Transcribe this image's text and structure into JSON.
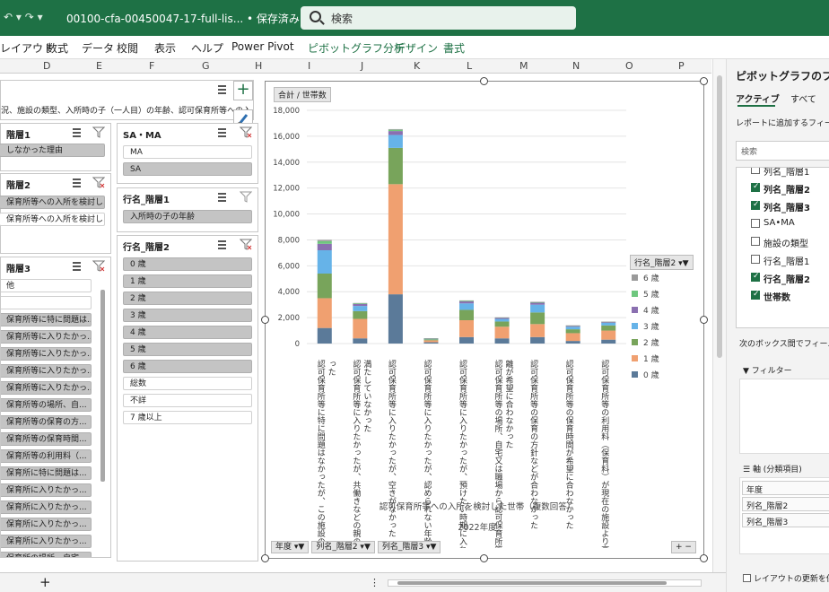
{
  "titlebar": {
    "undo_glyph": "↶ ▾ ↷ ▾",
    "filename": "00100-cfa-00450047-17-full-lis... • 保存済み ∨",
    "search_placeholder": "検索"
  },
  "ribbon_tabs": [
    "レイアウト",
    "数式",
    "データ",
    "校閲",
    "表示",
    "ヘルプ",
    "Power Pivot",
    "ピボットグラフ分析",
    "デザイン",
    "書式"
  ],
  "columns": [
    "D",
    "E",
    "F",
    "G",
    "H",
    "I",
    "J",
    "K",
    "L",
    "M",
    "N",
    "O",
    "P"
  ],
  "slicer_top": {
    "text": "況、施設の類型、入所時の子（一人目）の年齢、認可保育所等への入"
  },
  "slicer_a": {
    "header": "階層1",
    "items": [
      "しなかった理由"
    ]
  },
  "slicer_b": {
    "header": "階層2",
    "items": [
      "保育所等への入所を検討し...",
      "保育所等への入所を検討し..."
    ]
  },
  "slicer_c": {
    "header": "階層3",
    "items": [
      "他",
      "",
      "保育所等に特に問題は...",
      "保育所等に入りたかっ...",
      "保育所等に入りたかっ...",
      "保育所等に入りたかっ...",
      "保育所等に入りたかっ...",
      "保育所等の場所、自...",
      "保育所等の保育の方...",
      "保育所等の保育時間...",
      "保育所等の利用料（...",
      "保育所に特に問題は...",
      "保育所に入りたかっ...",
      "保育所に入りたかっ...",
      "保育所に入りたかっ...",
      "保育所に入りたかっ...",
      "保育所の場所、自宅..."
    ]
  },
  "slicer_sama": {
    "header": "SA・MA",
    "items": [
      "MA",
      "SA"
    ]
  },
  "slicer_row1": {
    "header": "行名_階層1",
    "items": [
      "入所時の子の年齢"
    ]
  },
  "slicer_row2": {
    "header": "行名_階層2",
    "items": [
      "0 歳",
      "1 歳",
      "2 歳",
      "3 歳",
      "4 歳",
      "5 歳",
      "6 歳",
      "総数",
      "不詳",
      "7 歳以上"
    ]
  },
  "chart": {
    "value_button": "合計 / 世帯数",
    "legend_button": "行名_階層2",
    "axis_buttons": [
      "年度",
      "列名_階層2",
      "列名_階層3"
    ],
    "xlabel": "認可保育所等への入所を検討した世帯（複数回答）",
    "xlabel2": "2022年度",
    "plus_minus": "+ −"
  },
  "chart_data": {
    "type": "bar",
    "stacked": true,
    "ylim": [
      0,
      18000
    ],
    "yticks": [
      "0",
      "2,000",
      "4,000",
      "6,000",
      "8,000",
      "10,000",
      "12,000",
      "14,000",
      "16,000",
      "18,000"
    ],
    "categories": [
      "認可保育所等に特に問題はなかったが、この施設のほうがよかった",
      "認可保育所等に入りたかったが、共働きなどの親の入所要件を満たしていなかった",
      "認可保育所等に入りたかったが、空きがなかった",
      "認可保育所等に入りたかったが、認められない年齢だった",
      "認可保育所等に入りたかったが、預けたい時期に入れなかった",
      "認可保育所等の場所、自宅又は職場から認可保育所等までの距離が希望に合わなかった",
      "認可保育所等の保育の方針などが合わなかった",
      "認可保育所等の保育時間が希望に合わなかった",
      "認可保育所等の利用料（保育料）が現在の施設より高かった"
    ],
    "series": [
      {
        "name": "0 歳",
        "color": "#5b7a99",
        "values": [
          1200,
          400,
          3800,
          100,
          500,
          400,
          500,
          200,
          300
        ]
      },
      {
        "name": "1 歳",
        "color": "#f0a070",
        "values": [
          2300,
          1500,
          8500,
          150,
          1300,
          900,
          1000,
          600,
          700
        ]
      },
      {
        "name": "2 歳",
        "color": "#78a45b",
        "values": [
          1900,
          600,
          2800,
          80,
          800,
          400,
          900,
          300,
          400
        ]
      },
      {
        "name": "3 歳",
        "color": "#66b3e8",
        "values": [
          1800,
          400,
          1000,
          40,
          500,
          200,
          600,
          200,
          200
        ]
      },
      {
        "name": "4 歳",
        "color": "#8a6fb0",
        "values": [
          500,
          150,
          300,
          20,
          150,
          80,
          150,
          60,
          60
        ]
      },
      {
        "name": "5 歳",
        "color": "#6ec77e",
        "values": [
          200,
          60,
          100,
          10,
          60,
          30,
          50,
          30,
          20
        ]
      },
      {
        "name": "6 歳",
        "color": "#9a9a9a",
        "values": [
          100,
          20,
          50,
          5,
          20,
          10,
          20,
          10,
          10
        ]
      }
    ]
  },
  "rpanel": {
    "title": "ピボットグラフのフィー",
    "tab_active": "アクティブ",
    "tab_all": "すべて",
    "report_text": "レポートに追加するフィール",
    "search_placeholder": "検索",
    "fields": [
      {
        "label": "列名_階層1",
        "checked": false
      },
      {
        "label": "列名_階層2",
        "checked": true
      },
      {
        "label": "列名_階層3",
        "checked": true
      },
      {
        "label": "SA•MA",
        "checked": false
      },
      {
        "label": "施設の類型",
        "checked": false
      },
      {
        "label": "行名_階層1",
        "checked": false
      },
      {
        "label": "行名_階層2",
        "checked": true
      },
      {
        "label": "世帯数",
        "checked": true
      }
    ],
    "drag_text": "次のボックス間でフィールド",
    "filter_label": "フィルター",
    "axis_label": "軸 (分類項目)",
    "axis_items": [
      "年度",
      "列名_階層2",
      "列名_階層3"
    ],
    "defer_label": "レイアウトの更新を保"
  },
  "status": {
    "add": "+"
  }
}
